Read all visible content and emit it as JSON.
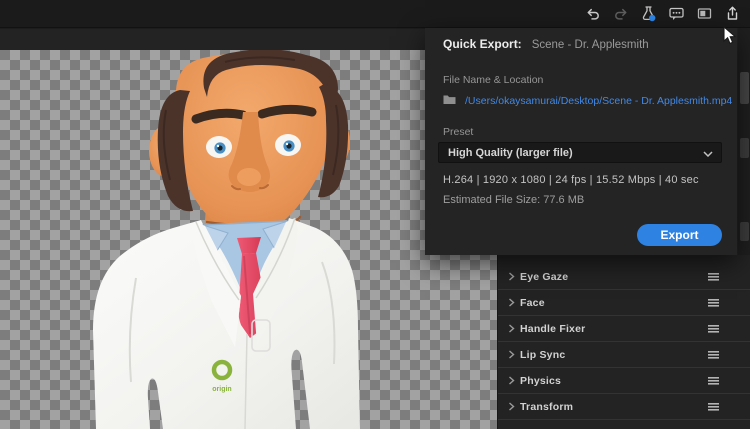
{
  "toolbar": {
    "icons": [
      "undo",
      "redo",
      "experimental-flask",
      "comments",
      "panel-layout",
      "export-share"
    ]
  },
  "quick_export": {
    "title_label": "Quick Export:",
    "title_value": "Scene - Dr. Applesmith",
    "file_section_label": "File Name & Location",
    "file_path": "/Users/okaysamurai/Desktop/Scene - Dr. Applesmith.mp4",
    "preset_label": "Preset",
    "preset_value": "High Quality (larger file)",
    "specs": "H.264 | 1920 x 1080 | 24 fps | 15.52 Mbps | 40 sec",
    "estimated_size": "Estimated File Size: 77.6 MB",
    "export_button": "Export"
  },
  "behaviors": {
    "items": [
      {
        "label": "Eye Gaze"
      },
      {
        "label": "Face"
      },
      {
        "label": "Handle Fixer"
      },
      {
        "label": "Lip Sync"
      },
      {
        "label": "Physics"
      },
      {
        "label": "Transform"
      }
    ]
  },
  "scene": {
    "character_name": "Dr. Applesmith",
    "coat_logo_text": "origin"
  },
  "colors": {
    "accent_blue": "#2e82e2",
    "link_blue": "#4189e8",
    "panel_bg": "#232323",
    "checker_light": "#a2a2a2",
    "checker_dark": "#7d7d7d"
  }
}
